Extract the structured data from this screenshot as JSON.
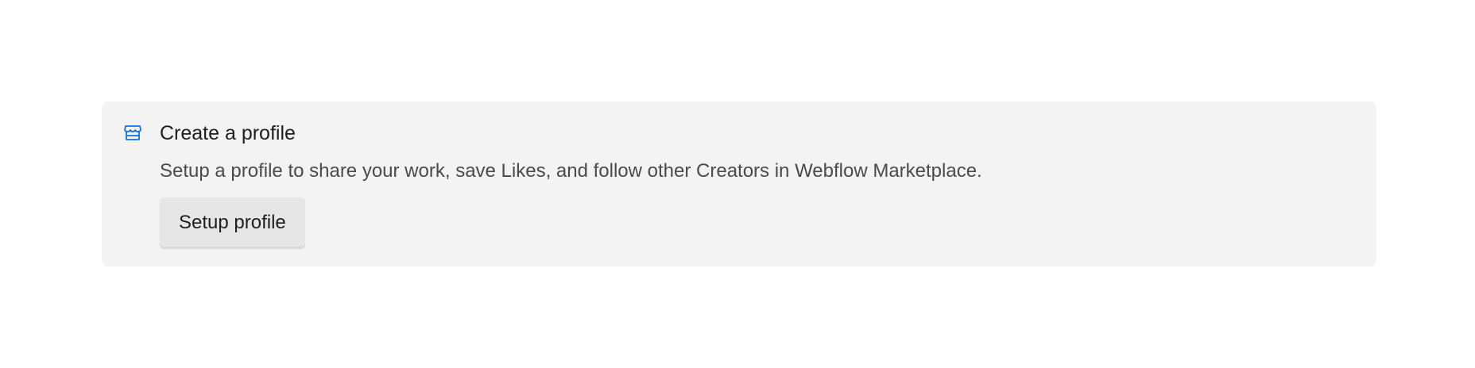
{
  "profile_card": {
    "icon": "storefront-icon",
    "title": "Create a profile",
    "description": "Setup a profile to share your work, save Likes, and follow other Creators in Webflow Marketplace.",
    "button_label": "Setup profile"
  },
  "colors": {
    "accent": "#146ef5",
    "card_background": "#f3f3f3",
    "button_background": "#e6e6e6"
  }
}
